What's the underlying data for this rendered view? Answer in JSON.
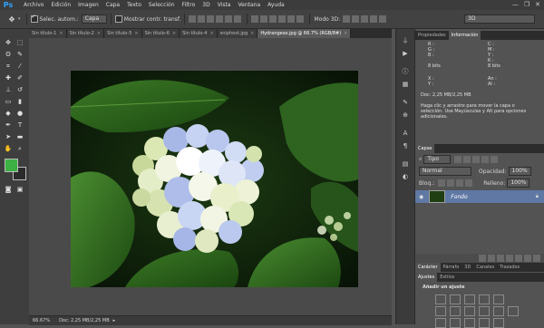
{
  "menu": {
    "logo": "Ps",
    "items": [
      "Archivo",
      "Edición",
      "Imagen",
      "Capa",
      "Texto",
      "Selección",
      "Filtro",
      "3D",
      "Vista",
      "Ventana",
      "Ayuda"
    ],
    "window_controls": [
      "—",
      "❐",
      "✕"
    ]
  },
  "options": {
    "auto_select_label": "Selec. autom.:",
    "auto_select_value": "Capa",
    "show_transform_label": "Mostrar contr. transf.",
    "mode_3d_label": "Modo 3D:",
    "workspace_value": "3D"
  },
  "tabs": [
    {
      "label": "Sin título-1",
      "active": false
    },
    {
      "label": "Sin título-2",
      "active": false
    },
    {
      "label": "Sin título-5",
      "active": false
    },
    {
      "label": "Sin título-6",
      "active": false
    },
    {
      "label": "Sin título-4",
      "active": false
    },
    {
      "label": "sniphost.jpg",
      "active": false
    },
    {
      "label": "Hydrangeas.jpg @ 66.7% (RGB/8#)",
      "active": true
    }
  ],
  "status": {
    "zoom": "66.67%",
    "doc": "Doc: 2,25 MB/2,25 MB"
  },
  "info_panel": {
    "tabs": [
      "Propiedades",
      "Información"
    ],
    "rgb_labels": [
      "R :",
      "G :",
      "B :"
    ],
    "cmyk_labels": [
      "C :",
      "M :",
      "Y :",
      "K :"
    ],
    "bits_left": "8 bits",
    "bits_right": "8 bits",
    "xy_labels": [
      "X :",
      "Y :"
    ],
    "wh_labels": [
      "An :",
      "Al :"
    ],
    "doc": "Doc: 2,25 MB/2,25 MB",
    "hint": "Haga clic y arrastre para mover la capa o selección. Use Mayúsculas y Alt para opciones adicionales."
  },
  "layers_panel": {
    "tab": "Capas",
    "kind_filter": "Tipo",
    "blend_mode": "Normal",
    "opacity_label": "Opacidad:",
    "opacity_value": "100%",
    "lock_label": "Bloq.:",
    "fill_label": "Relleno:",
    "fill_value": "100%",
    "layer_name": "Fondo"
  },
  "adjust_panel": {
    "tabs_top": [
      "Carácter",
      "Párrafo",
      "3D",
      "Canales",
      "Trazados"
    ],
    "tabs": [
      "Ajustes",
      "Estilos"
    ],
    "add_label": "Añadir un ajuste"
  },
  "colors": {
    "foreground": "#3cb043",
    "background": "#2b2b2b",
    "accent": "#2fa3ff"
  }
}
